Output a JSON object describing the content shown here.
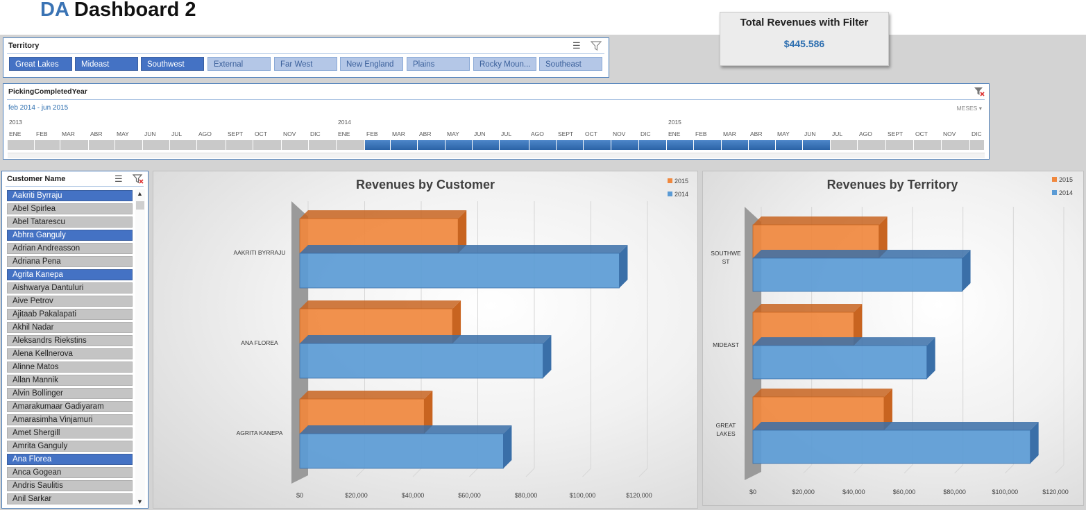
{
  "header": {
    "title_prefix": "DA",
    "title_rest": "Dashboard 2"
  },
  "kpi": {
    "title": "Total Revenues with Filter",
    "value": "$445.586"
  },
  "territory_slicer": {
    "header": "Territory",
    "items": [
      {
        "label": "Great Lakes",
        "selected": true
      },
      {
        "label": "Mideast",
        "selected": true
      },
      {
        "label": "Southwest",
        "selected": true
      },
      {
        "label": "External",
        "selected": false
      },
      {
        "label": "Far West",
        "selected": false
      },
      {
        "label": "New England",
        "selected": false
      },
      {
        "label": "Plains",
        "selected": false
      },
      {
        "label": "Rocky Moun...",
        "selected": false
      },
      {
        "label": "Southeast",
        "selected": false
      }
    ]
  },
  "timeline": {
    "header": "PickingCompletedYear",
    "range_label": "feb 2014 - jun 2015",
    "level_label": "MESES",
    "years": [
      "2013",
      "2014",
      "2015"
    ],
    "months": [
      "ENE",
      "FEB",
      "MAR",
      "ABR",
      "MAY",
      "JUN",
      "JUL",
      "AGO",
      "SEPT",
      "OCT",
      "NOV",
      "DIC",
      "ENE",
      "FEB",
      "MAR",
      "ABR",
      "MAY",
      "JUN",
      "JUL",
      "AGO",
      "SEPT",
      "OCT",
      "NOV",
      "DIC",
      "ENE",
      "FEB",
      "MAR",
      "ABR",
      "MAY",
      "JUN",
      "JUL",
      "AGO",
      "SEPT",
      "OCT",
      "NOV",
      "DIC"
    ],
    "selected_from_index": 13,
    "selected_to_index": 29
  },
  "customer_slicer": {
    "header": "Customer Name",
    "items": [
      {
        "label": "Aakriti Byrraju",
        "selected": true
      },
      {
        "label": "Abel Spirlea",
        "selected": false
      },
      {
        "label": "Abel Tatarescu",
        "selected": false
      },
      {
        "label": "Abhra Ganguly",
        "selected": true
      },
      {
        "label": "Adrian Andreasson",
        "selected": false
      },
      {
        "label": "Adriana Pena",
        "selected": false
      },
      {
        "label": "Agrita Kanepa",
        "selected": true
      },
      {
        "label": "Aishwarya Dantuluri",
        "selected": false
      },
      {
        "label": "Aive Petrov",
        "selected": false
      },
      {
        "label": "Ajitaab Pakalapati",
        "selected": false
      },
      {
        "label": "Akhil Nadar",
        "selected": false
      },
      {
        "label": "Aleksandrs Riekstins",
        "selected": false
      },
      {
        "label": "Alena Kellnerova",
        "selected": false
      },
      {
        "label": "Alinne Matos",
        "selected": false
      },
      {
        "label": "Allan Mannik",
        "selected": false
      },
      {
        "label": "Alvin Bollinger",
        "selected": false
      },
      {
        "label": "Amarakumaar Gadiyaram",
        "selected": false
      },
      {
        "label": "Amarasimha Vinjamuri",
        "selected": false
      },
      {
        "label": "Amet Shergill",
        "selected": false
      },
      {
        "label": "Amrita Ganguly",
        "selected": false
      },
      {
        "label": "Ana Florea",
        "selected": true
      },
      {
        "label": "Anca Gogean",
        "selected": false
      },
      {
        "label": "Andris Saulitis",
        "selected": false
      },
      {
        "label": "Anil Sarkar",
        "selected": false
      }
    ]
  },
  "colors": {
    "accent": "#3a73b4",
    "series_2015": "#f0883e",
    "series_2014": "#5b9bd5",
    "slicer_selected": "#4472c4",
    "slicer_unselected": "#b4c7e7"
  },
  "chart_data": [
    {
      "type": "bar",
      "title": "Revenues by Customer",
      "categories": [
        "AAKRITI BYRRAJU",
        "ANA FLOREA",
        "AGRITA KANEPA"
      ],
      "series": [
        {
          "name": "2015",
          "values": [
            56000,
            54000,
            44000
          ]
        },
        {
          "name": "2014",
          "values": [
            113000,
            86000,
            72000
          ]
        }
      ],
      "xlim": [
        0,
        120000
      ],
      "ticks": [
        "$0",
        "$20,000",
        "$40,000",
        "$60,000",
        "$80,000",
        "$100,000",
        "$120,000"
      ],
      "legend": "top-right",
      "orientation": "horizontal",
      "style": "3d"
    },
    {
      "type": "bar",
      "title": "Revenues by Territory",
      "categories": [
        "SOUTHWEST",
        "MIDEAST",
        "GREAT LAKES"
      ],
      "category_lines": [
        [
          "SOUTHWE",
          "ST"
        ],
        [
          "MIDEAST"
        ],
        [
          "GREAT",
          "LAKES"
        ]
      ],
      "series": [
        {
          "name": "2015",
          "values": [
            50000,
            40000,
            52000
          ]
        },
        {
          "name": "2014",
          "values": [
            83000,
            69000,
            110000
          ]
        }
      ],
      "xlim": [
        0,
        120000
      ],
      "ticks": [
        "$0",
        "$20,000",
        "$40,000",
        "$60,000",
        "$80,000",
        "$100,000",
        "$120,000"
      ],
      "legend": "top-right",
      "orientation": "horizontal",
      "style": "3d"
    }
  ]
}
